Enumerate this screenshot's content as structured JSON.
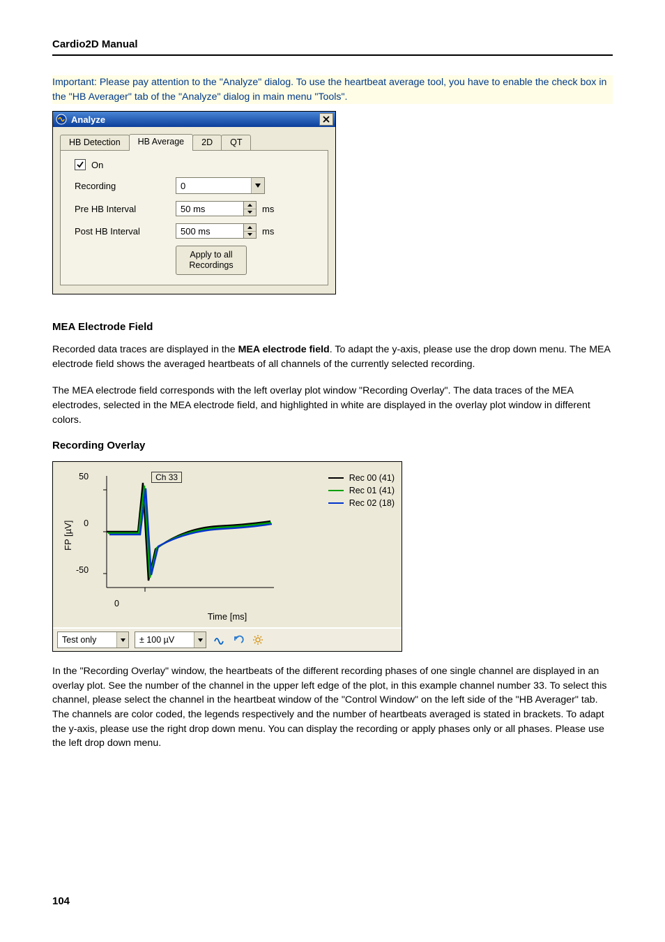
{
  "header": {
    "title": "Cardio2D Manual"
  },
  "important_note": "Important: Please pay attention to the \"Analyze\" dialog. To use the heartbeat average tool, you have to enable the check box in the \"HB Averager\" tab of the \"Analyze\" dialog in main menu \"Tools\".",
  "dialog": {
    "title": "Analyze",
    "tabs": [
      "HB Detection",
      "HB Average",
      "2D",
      "QT"
    ],
    "active_tab_index": 1,
    "on_checkbox_label": "On",
    "recording_label": "Recording",
    "recording_value": "0",
    "pre_hb_label": "Pre HB Interval",
    "pre_hb_value": "50 ms",
    "pre_hb_unit": "ms",
    "post_hb_label": "Post HB Interval",
    "post_hb_value": "500 ms",
    "post_hb_unit": "ms",
    "apply_btn": "Apply to all\nRecordings"
  },
  "section_mea_title": "MEA Electrode Field",
  "section_mea_p1_a": "Recorded data traces are displayed in the ",
  "section_mea_p1_bold": "MEA electrode field",
  "section_mea_p1_b": ". To adapt the y-axis, please use the drop down menu. The MEA electrode field shows the averaged heartbeats of all channels of the currently selected recording.",
  "section_mea_p2": "The MEA electrode field corresponds with the left overlay plot window \"Recording Overlay\". The data traces of the MEA electrodes, selected in the MEA electrode field, and highlighted in white are displayed in the overlay plot window in different colors.",
  "section_overlay_title": "Recording Overlay",
  "chart_data": {
    "type": "line",
    "title": "",
    "xlabel": "Time [ms]",
    "ylabel": "FP [µV]",
    "ylim": [
      -70,
      70
    ],
    "yticks": [
      50,
      0,
      -50
    ],
    "xticks": [
      0
    ],
    "channel_label": "Ch 33",
    "series": [
      {
        "name": "Rec 00 (41)",
        "color": "#000000"
      },
      {
        "name": "Rec 01 (41)",
        "color": "#00a000"
      },
      {
        "name": "Rec 02 (18)",
        "color": "#0033cc"
      }
    ]
  },
  "chart_toolbar": {
    "left_combo": "Test only",
    "right_combo": "± 100 µV"
  },
  "section_overlay_p1": "In the \"Recording Overlay\" window, the heartbeats of the different recording phases of one single channel are displayed in an overlay plot. See the number of the channel in the upper left edge of the plot, in this example channel number 33. To select this channel, please select the channel in the heartbeat window of the \"Control Window\" on the left side of the \"HB Averager\" tab. The channels are color coded, the legends respectively and the number of heartbeats averaged is stated in brackets. To adapt the y-axis, please use the right drop down menu. You can display the recording or apply phases only or all phases. Please use the left drop down menu.",
  "page_number": "104"
}
